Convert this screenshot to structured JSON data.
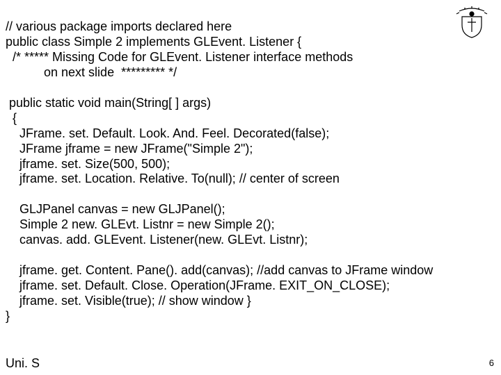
{
  "code": {
    "line1": "// various package imports declared here",
    "line2": "public class Simple 2 implements GLEvent. Listener {",
    "line3": "  /* ***** Missing Code for GLEvent. Listener interface methods",
    "line4": "           on next slide  ********* */",
    "line5": "",
    "line6": " public static void main(String[ ] args)",
    "line7": "  {",
    "line8": "    JFrame. set. Default. Look. And. Feel. Decorated(false);",
    "line9": "    JFrame jframe = new JFrame(\"Simple 2\");",
    "line10": "    jframe. set. Size(500, 500);",
    "line11": "    jframe. set. Location. Relative. To(null); // center of screen",
    "line12": "",
    "line13": "    GLJPanel canvas = new GLJPanel();",
    "line14": "    Simple 2 new. GLEvt. Listnr = new Simple 2();",
    "line15": "    canvas. add. GLEvent. Listener(new. GLEvt. Listnr);",
    "line16": "",
    "line17": "    jframe. get. Content. Pane(). add(canvas); //add canvas to JFrame window",
    "line18": "    jframe. set. Default. Close. Operation(JFrame. EXIT_ON_CLOSE);",
    "line19": "    jframe. set. Visible(true); // show window }",
    "line20": "}"
  },
  "footer": "Uni. S",
  "pagenum": "6"
}
